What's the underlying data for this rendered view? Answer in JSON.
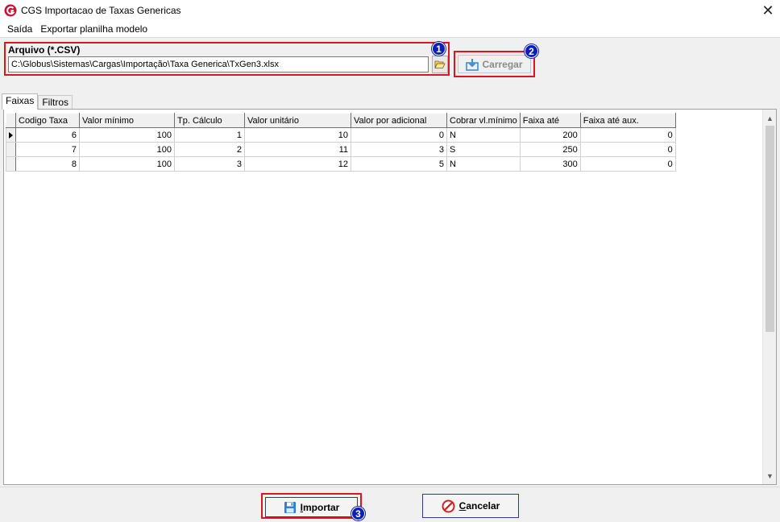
{
  "window": {
    "title": "CGS Importacao de Taxas Genericas"
  },
  "menu": {
    "items": [
      "Saída",
      "Exportar planilha modelo"
    ]
  },
  "file_section": {
    "label": "Arquivo (*.CSV)",
    "path_value": "C:\\Globus\\Sistemas\\Cargas\\Importação\\Taxa Generica\\TxGen3.xlsx",
    "browse_icon": "folder-open-icon",
    "badge": "1"
  },
  "load_section": {
    "button_label": "Carregar",
    "badge": "2"
  },
  "tabs": [
    {
      "label": "Faixas",
      "active": true
    },
    {
      "label": "Filtros",
      "active": false
    }
  ],
  "grid": {
    "columns": [
      "Codigo Taxa",
      "Valor mínimo",
      "Tp. Cálculo",
      "Valor unitário",
      "Valor por adicional",
      "Cobrar vl.mínimo",
      "Faixa até",
      "Faixa até aux."
    ],
    "rows": [
      [
        "6",
        "100",
        "1",
        "10",
        "0",
        "N",
        "200",
        "0"
      ],
      [
        "7",
        "100",
        "2",
        "11",
        "3",
        "S",
        "250",
        "0"
      ],
      [
        "8",
        "100",
        "3",
        "12",
        "5",
        "N",
        "300",
        "0"
      ]
    ]
  },
  "footer": {
    "import_label_first": "I",
    "import_label_rest": "mportar",
    "cancel_label_first": "C",
    "cancel_label_rest": "ancelar",
    "badge": "3"
  },
  "colors": {
    "highlight_border": "#e0141c",
    "badge_bg": "#0a1fb8",
    "app_icon": "#c8102e"
  }
}
